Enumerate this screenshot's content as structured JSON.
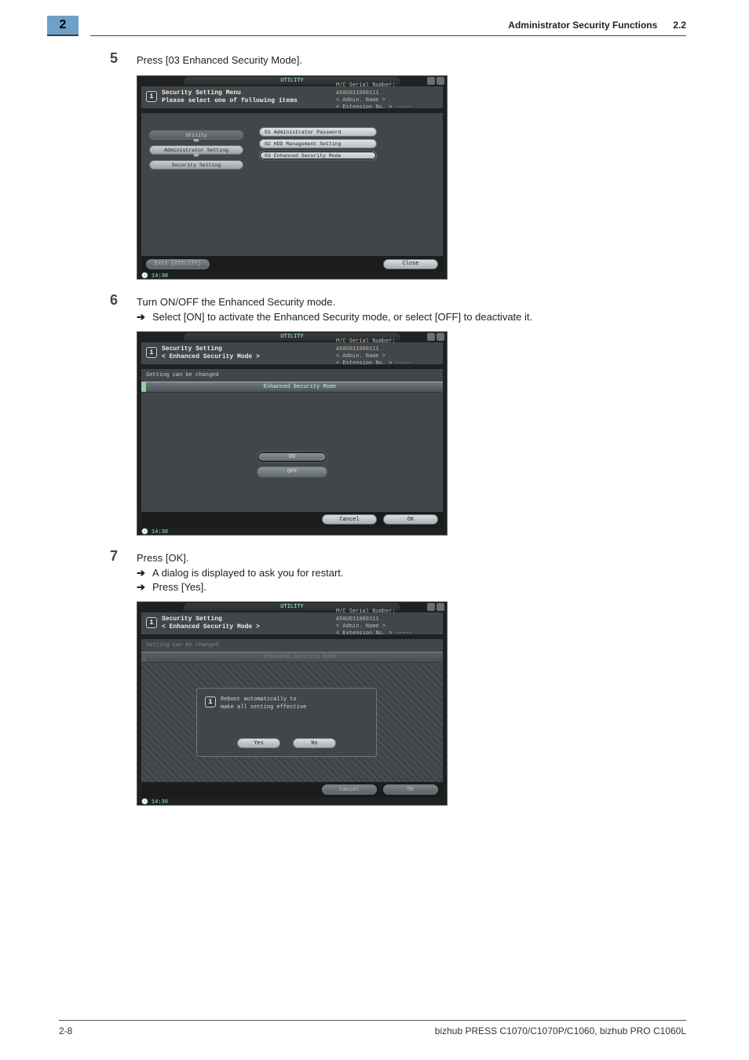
{
  "page": {
    "chapter_tab": "2",
    "header_title": "Administrator Security Functions",
    "header_section": "2.2",
    "footer_left": "2-8",
    "footer_right": "bizhub PRESS C1070/C1070P/C1060, bizhub PRO C1060L"
  },
  "steps": {
    "s5": {
      "num": "5",
      "text": "Press [03 Enhanced Security Mode]."
    },
    "s6": {
      "num": "6",
      "text": "Turn ON/OFF the Enhanced Security mode.",
      "sub1": "Select [ON] to activate the Enhanced Security mode, or select [OFF] to deactivate it."
    },
    "s7": {
      "num": "7",
      "text": "Press [OK].",
      "sub1": "A dialog is displayed to ask you for restart.",
      "sub2": "Press [Yes]."
    }
  },
  "shot_common": {
    "tab": "UTILITY",
    "meta_serial": "M/C Serial Number: A50U011000111",
    "meta_admin": "< Admin. Name >",
    "meta_ext": "< Extension No. >  -----",
    "time": "14:30"
  },
  "shot1": {
    "hdr1": "Security Setting Menu",
    "hdr2": "Please select one of following items",
    "crumb1": "Utility",
    "crumb2": "Administrator Setting",
    "crumb3": "Security Setting",
    "menu1": "01 Administrator Password",
    "menu2": "02 HDD Management Setting",
    "menu3": "03 Enhanced Security Mode",
    "footer_left": "Exit [UTILITY]",
    "footer_right": "Close"
  },
  "shot2": {
    "hdr1": "Security Setting",
    "hdr2": "< Enhanced Security Mode >",
    "note": "Setting can be changed",
    "bar_caption": "Enhanced Security Mode",
    "btn_on": "ON",
    "btn_off": "OFF",
    "cancel": "Cancel",
    "ok": "OK"
  },
  "shot3": {
    "hdr1": "Security Setting",
    "hdr2": "< Enhanced Security Mode >",
    "note": "Setting can be changed",
    "bar_caption": "Enhanced Security Mode",
    "dlg1": "Reboot automatically to",
    "dlg2": "make all setting effective",
    "yes": "Yes",
    "no": "No",
    "cancel": "Cancel",
    "ok": "OK"
  }
}
